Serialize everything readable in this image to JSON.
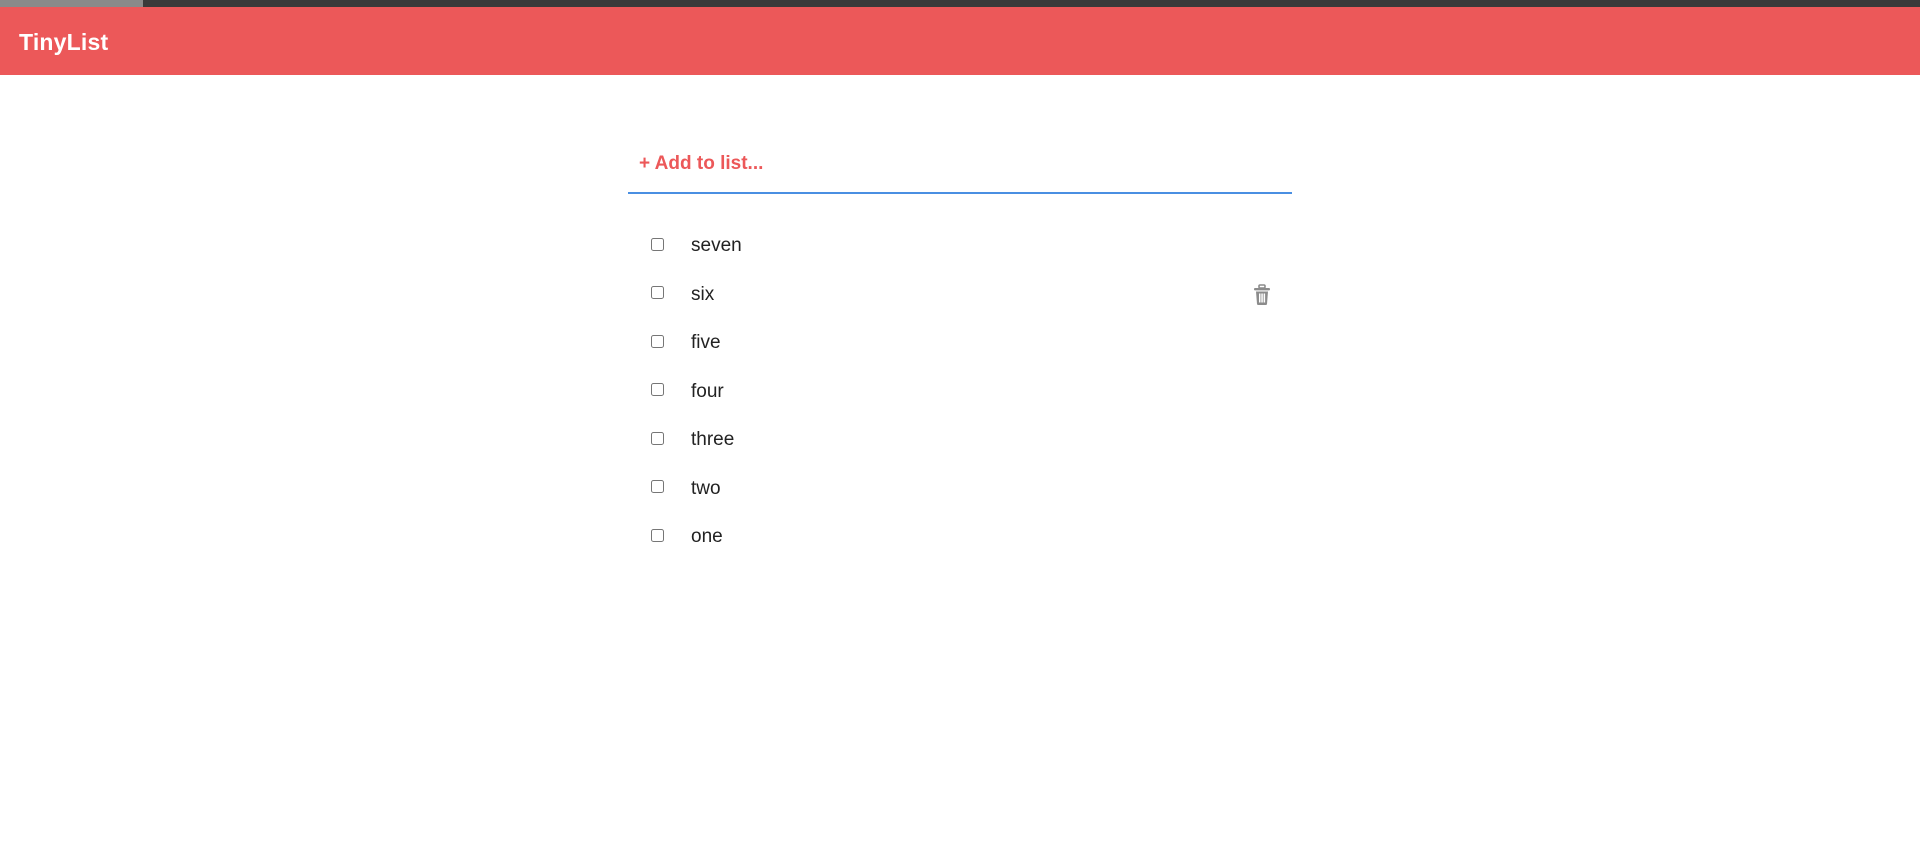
{
  "app": {
    "title": "TinyList"
  },
  "colors": {
    "brand": "#ec5859",
    "focus_underline": "#4a8fe2",
    "text": "#222222",
    "icon": "#8c8c8c"
  },
  "add": {
    "placeholder": "+ Add to list..."
  },
  "items": [
    {
      "label": "seven",
      "checked": false,
      "shows_delete": false
    },
    {
      "label": "six",
      "checked": false,
      "shows_delete": true
    },
    {
      "label": "five",
      "checked": false,
      "shows_delete": false
    },
    {
      "label": "four",
      "checked": false,
      "shows_delete": false
    },
    {
      "label": "three",
      "checked": false,
      "shows_delete": false
    },
    {
      "label": "two",
      "checked": false,
      "shows_delete": false
    },
    {
      "label": "one",
      "checked": false,
      "shows_delete": false
    }
  ],
  "icons": {
    "delete": "trash-icon"
  }
}
